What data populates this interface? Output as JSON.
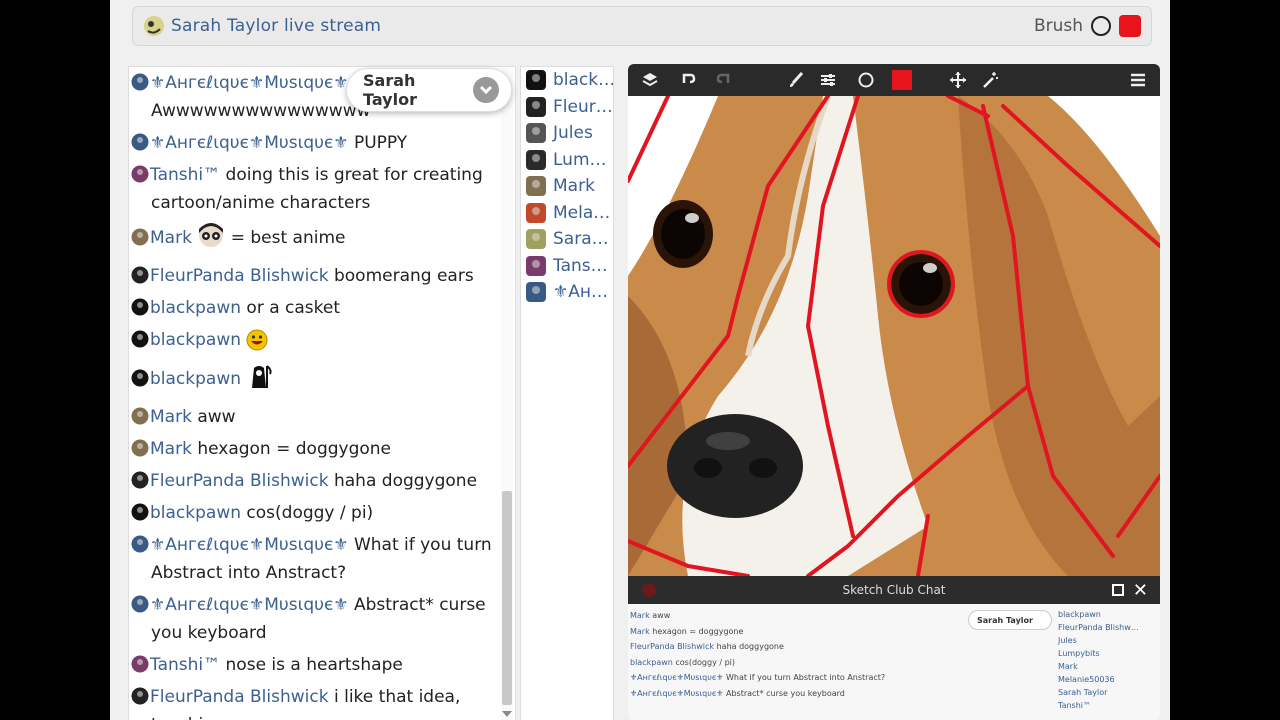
{
  "header": {
    "title": "Sarah Taylor live stream",
    "tool_label": "Brush",
    "brush_color": "#e8141c"
  },
  "user_dropdown": {
    "name": "Sarah Taylor"
  },
  "messages": [
    {
      "user": "⚜Ангєℓιqυє⚜Мυsιqυє⚜",
      "text": "Awwwwwwwwwwwwwww",
      "avatar": "#3a5a86"
    },
    {
      "user": "⚜Ангєℓιqυє⚜Мυsιqυє⚜",
      "text": "PUPPY",
      "avatar": "#3a5a86"
    },
    {
      "user": "Tanshi™",
      "text": "doing this is great for creating cartoon/anime characters",
      "avatar": "#7a3a6a"
    },
    {
      "user": "Mark",
      "text": "= best anime",
      "avatar": "#807050",
      "emoji": "face"
    },
    {
      "user": "FleurPanda Blishwick",
      "text": "boomerang ears",
      "avatar": "#222222"
    },
    {
      "user": "blackpawn",
      "text": "or a casket",
      "avatar": "#111111"
    },
    {
      "user": "blackpawn",
      "text": "",
      "avatar": "#111111",
      "emoji": "smile"
    },
    {
      "user": "blackpawn",
      "text": "",
      "avatar": "#111111",
      "emoji": "reaper"
    },
    {
      "user": "Mark",
      "text": "aww",
      "avatar": "#807050"
    },
    {
      "user": "Mark",
      "text": "hexagon = doggygone",
      "avatar": "#807050"
    },
    {
      "user": "FleurPanda Blishwick",
      "text": "haha doggygone",
      "avatar": "#222222"
    },
    {
      "user": "blackpawn",
      "text": "cos(doggy / pi)",
      "avatar": "#111111"
    },
    {
      "user": "⚜Ангєℓιqυє⚜Мυsιqυє⚜",
      "text": "What if you turn Abstract into Anstract?",
      "avatar": "#3a5a86"
    },
    {
      "user": "⚜Ангєℓιqυє⚜Мυsιqυє⚜",
      "text": "Abstract* curse you keyboard",
      "avatar": "#3a5a86"
    },
    {
      "user": "Tanshi™",
      "text": "nose is a heartshape",
      "avatar": "#7a3a6a"
    },
    {
      "user": "FleurPanda Blishwick",
      "text": "i like that idea, tanshi",
      "avatar": "#222222"
    }
  ],
  "users": [
    {
      "name": "black…",
      "avatar": "#111111"
    },
    {
      "name": "Fleur…",
      "avatar": "#222222"
    },
    {
      "name": "Jules",
      "avatar": "#555555"
    },
    {
      "name": "Lum…",
      "avatar": "#2a2a2a"
    },
    {
      "name": "Mark",
      "avatar": "#807050"
    },
    {
      "name": "Mela…",
      "avatar": "#c04a2a"
    },
    {
      "name": "Sara…",
      "avatar": "#a0a060"
    },
    {
      "name": "Tans…",
      "avatar": "#7a3a6a"
    },
    {
      "name": "⚜Ан…",
      "avatar": "#3a5a86"
    }
  ],
  "canvas": {
    "toolbar_icons": [
      "layers-icon",
      "undo-icon",
      "redo-icon",
      "brush-icon",
      "sliders-icon",
      "circle-icon",
      "color-swatch",
      "move-icon",
      "magic-wand-icon",
      "menu-icon"
    ]
  },
  "mini_chat": {
    "title": "Sketch Club Chat",
    "dropdown": "Sarah Taylor",
    "messages": [
      {
        "user": "Mark",
        "text": "aww"
      },
      {
        "user": "Mark",
        "text": "hexagon = doggygone"
      },
      {
        "user": "FleurPanda Blishwick",
        "text": "haha doggygone"
      },
      {
        "user": "blackpawn",
        "text": "cos(doggy / pi)"
      },
      {
        "user": "⚜Ангєℓιqυє⚜Мυsιqυє⚜",
        "text": "What if you turn Abstract into Anstract?"
      },
      {
        "user": "⚜Ангєℓιqυє⚜Мυsιqυє⚜",
        "text": "Abstract* curse you keyboard"
      }
    ],
    "users": [
      "blackpawn",
      "FleurPanda Blishw…",
      "Jules",
      "Lumpybits",
      "Mark",
      "Melanie50036",
      "Sarah Taylor",
      "Tanshi™"
    ]
  }
}
